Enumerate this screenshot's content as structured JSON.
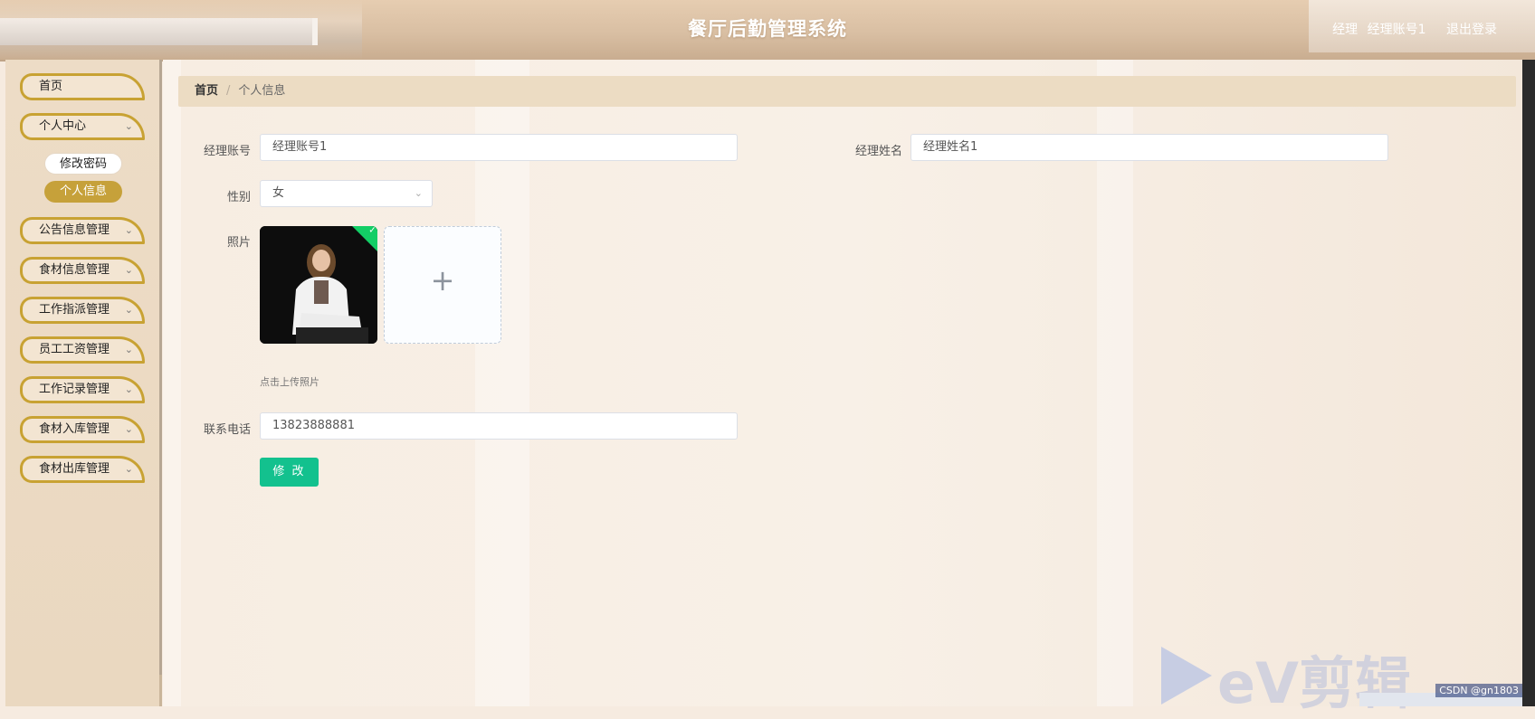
{
  "header": {
    "title": "餐厅后勤管理系统",
    "role": "经理",
    "account": "经理账号1",
    "logout": "退出登录"
  },
  "sidebar": {
    "items": [
      {
        "label": "首页"
      },
      {
        "label": "个人中心",
        "expanded": true,
        "children": [
          "修改密码",
          "个人信息"
        ]
      },
      {
        "label": "公告信息管理"
      },
      {
        "label": "食材信息管理"
      },
      {
        "label": "工作指派管理"
      },
      {
        "label": "员工工资管理"
      },
      {
        "label": "工作记录管理"
      },
      {
        "label": "食材入库管理"
      },
      {
        "label": "食材出库管理"
      }
    ],
    "active_sub": "个人信息"
  },
  "breadcrumb": {
    "home": "首页",
    "separator": "/",
    "current": "个人信息"
  },
  "form": {
    "account_label": "经理账号",
    "account_value": "经理账号1",
    "name_label": "经理姓名",
    "name_value": "经理姓名1",
    "gender_label": "性别",
    "gender_value": "女",
    "photo_label": "照片",
    "photo_hint": "点击上传照片",
    "phone_label": "联系电话",
    "phone_value": "13823888881",
    "submit_label": "修 改"
  },
  "overlay": {
    "watermark": "eV剪辑",
    "csdn": "CSDN @gn1803"
  },
  "colors": {
    "accent_gold": "#c6a13a",
    "submit_green": "#13c18e",
    "breadcrumb_bg": "#ecdcc3"
  }
}
